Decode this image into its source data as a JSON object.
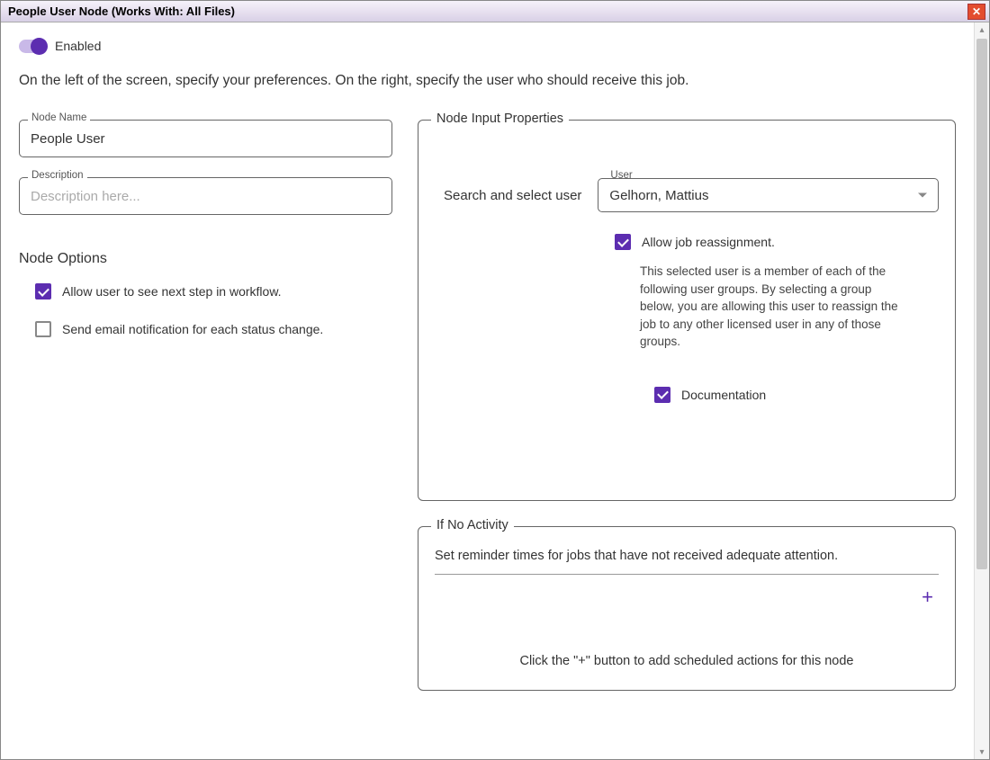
{
  "window": {
    "title": "People User Node (Works With: All Files)"
  },
  "toggle": {
    "label": "Enabled"
  },
  "intro": "On the left of the screen, specify your preferences. On the right, specify the user who should receive this job.",
  "left": {
    "nodeNameLabel": "Node Name",
    "nodeNameValue": "People User",
    "descriptionLabel": "Description",
    "descriptionPlaceholder": "Description here...",
    "optionsTitle": "Node Options",
    "opt1": "Allow user to see next step in workflow.",
    "opt2": "Send email notification for each status change."
  },
  "right": {
    "groupTitle": "Node Input Properties",
    "searchLabel": "Search and select user",
    "userFieldLabel": "User",
    "userValue": "Gelhorn, Mattius",
    "reassignLabel": "Allow job reassignment.",
    "reassignHelp": "This selected user is a member of each of the following user groups. By selecting a group below, you are allowing this user to reassign the job to any other licensed user in any of those groups.",
    "docLabel": "Documentation"
  },
  "noActivity": {
    "title": "If No Activity",
    "desc": "Set reminder times for jobs that have not received adequate attention.",
    "empty": "Click the \"+\" button to add scheduled actions for this node"
  }
}
